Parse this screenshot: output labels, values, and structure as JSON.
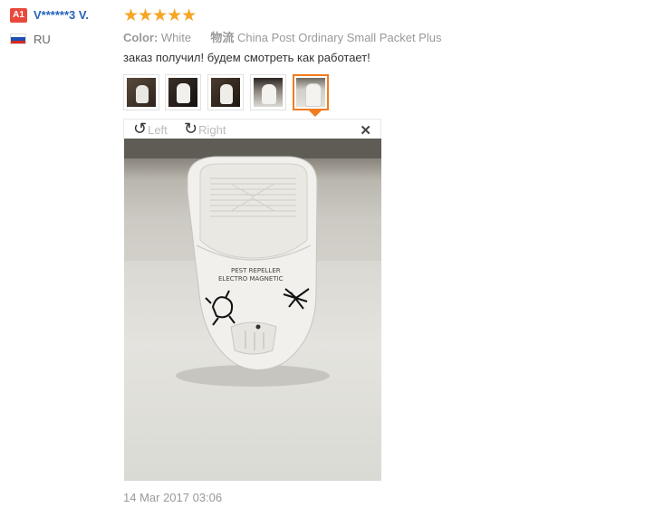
{
  "reviewer": {
    "badge": "A1",
    "name": "V******3 V.",
    "country": "RU",
    "flag_colors": [
      "#ffffff",
      "#1c4fb5",
      "#d52b1e"
    ]
  },
  "rating": {
    "stars": 5,
    "stars_text": "★★★★★"
  },
  "attributes": {
    "color_label": "Color:",
    "color_value": "White",
    "shipping_label": "物流",
    "shipping_value": "China Post Ordinary Small Packet Plus"
  },
  "review_text": "заказ получил! будем смотреть как работает!",
  "thumbnails": {
    "count": 5,
    "selected_index": 4
  },
  "viewer": {
    "rotate_left_label": "Left",
    "rotate_right_label": "Right",
    "rotate_left_icon": "rotate-left-icon",
    "rotate_right_icon": "rotate-right-icon",
    "close_icon": "close-icon",
    "close_glyph": "✕"
  },
  "photo": {
    "device_line1": "PEST REPELLER",
    "device_line2": "ELECTRO  MAGNETIC"
  },
  "timestamp": "14 Mar 2017 03:06",
  "colors": {
    "accent": "#f07c20",
    "link": "#2362b8",
    "badge": "#e8493c",
    "stars": "#f5a623"
  }
}
